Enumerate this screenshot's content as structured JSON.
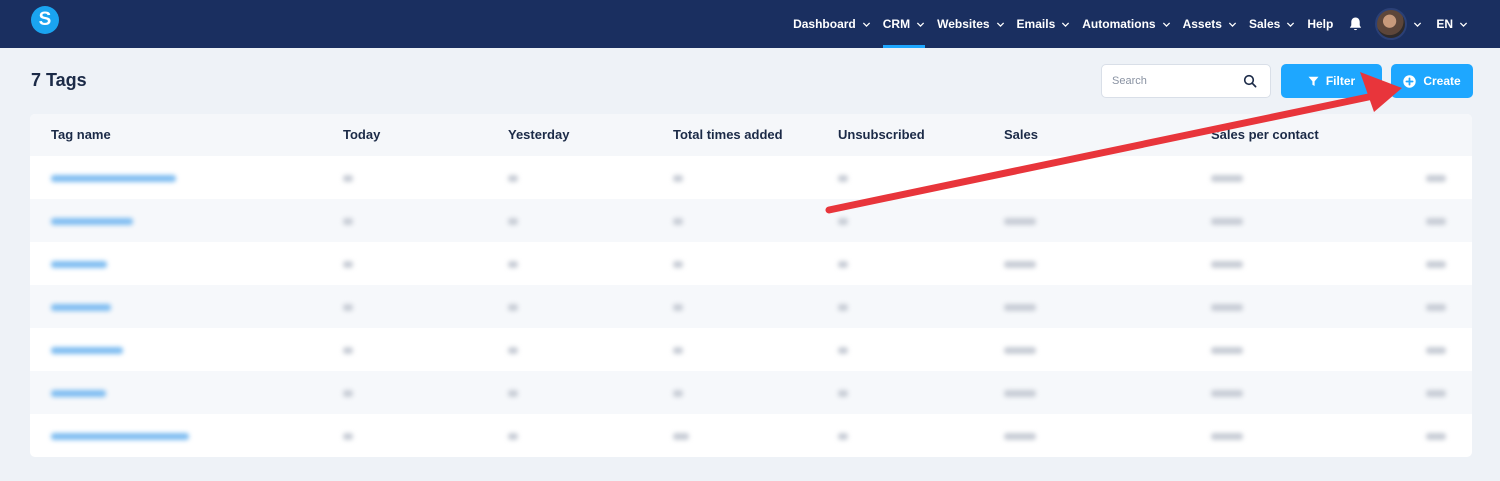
{
  "app": {
    "logo_letter": "S"
  },
  "nav": {
    "items": [
      {
        "label": "Dashboard",
        "has_chevron": true
      },
      {
        "label": "CRM",
        "has_chevron": true,
        "active": true
      },
      {
        "label": "Websites",
        "has_chevron": true
      },
      {
        "label": "Emails",
        "has_chevron": true
      },
      {
        "label": "Automations",
        "has_chevron": true
      },
      {
        "label": "Assets",
        "has_chevron": true
      },
      {
        "label": "Sales",
        "has_chevron": true
      },
      {
        "label": "Help",
        "has_chevron": false
      }
    ],
    "language": "EN",
    "icons": [
      "bell-icon",
      "avatar",
      "chevron-down-icon"
    ]
  },
  "page": {
    "title": "7 Tags"
  },
  "toolbar": {
    "search_placeholder": "Search",
    "filter_label": "Filter",
    "create_label": "Create"
  },
  "table": {
    "columns": [
      "Tag name",
      "Today",
      "Yesterday",
      "Total times added",
      "Unsubscribed",
      "Sales",
      "Sales per contact"
    ],
    "row_count": 7,
    "rows_obscured": true
  },
  "colors": {
    "navbar": "#1a2f60",
    "accent": "#1ea7ff",
    "annotation_arrow": "#e8353b"
  }
}
